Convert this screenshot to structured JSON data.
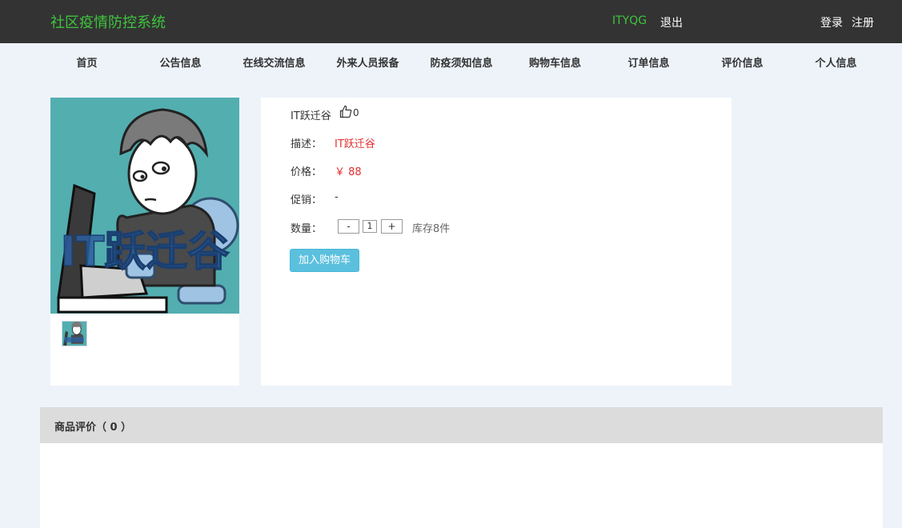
{
  "header": {
    "site_title": "社区疫情防控系统",
    "username": "ITYQG",
    "logout_label": "退出",
    "login_label": "登录",
    "register_label": "注册"
  },
  "nav": {
    "items": [
      {
        "label": "首页"
      },
      {
        "label": "公告信息"
      },
      {
        "label": "在线交流信息"
      },
      {
        "label": "外来人员报备"
      },
      {
        "label": "防疫须知信息"
      },
      {
        "label": "购物车信息"
      },
      {
        "label": "订单信息"
      },
      {
        "label": "评价信息"
      },
      {
        "label": "个人信息"
      }
    ]
  },
  "product": {
    "image_text": "IT跃迁谷",
    "name": "IT跃迁谷",
    "likes": "0",
    "desc_label": "描述：",
    "desc_value": "IT跃迁谷",
    "price_label": "价格：",
    "price_value": "￥ 88",
    "promo_label": "促销：",
    "promo_value": "-",
    "qty_label": "数量：",
    "qty_minus": "-",
    "qty_value": "1",
    "qty_plus": "+",
    "stock_text": "库存8件",
    "add_cart_label": "加入购物车"
  },
  "reviews": {
    "title": "商品评价（ 0 ）"
  },
  "colors": {
    "topbar": "#333333",
    "accent_green": "#3ec43e",
    "price_red": "#e62e2e",
    "button_blue": "#5bc0de",
    "page_bg": "#eef3fa"
  }
}
